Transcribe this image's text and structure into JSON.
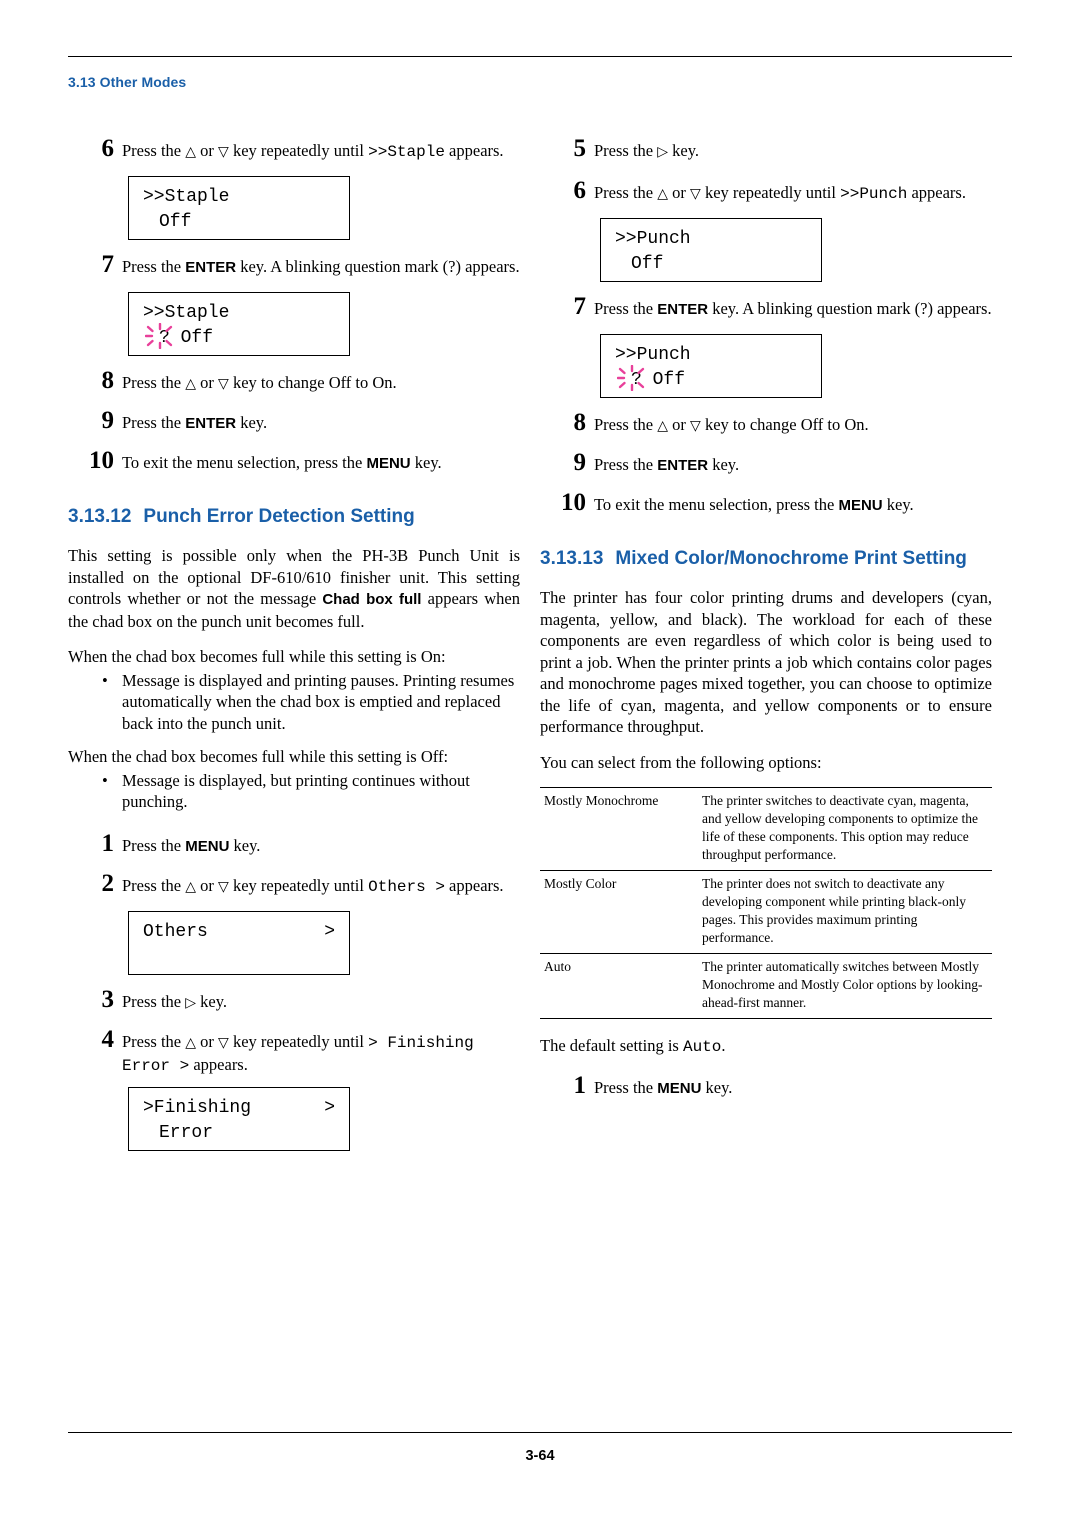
{
  "header": {
    "section": "3.13 Other Modes"
  },
  "footer": {
    "page": "3-64"
  },
  "left": {
    "steps": [
      {
        "num": "6",
        "pre": "Press the ",
        "tri1": "△",
        "mid": " or ",
        "tri2": "▽",
        "post": " key repeatedly until ",
        "mono": ">>Staple",
        "tail": " appears."
      },
      {
        "num": "7",
        "pre": "Press the ",
        "key": "ENTER",
        "post": " key. A blinking question mark (?) appears."
      },
      {
        "num": "8",
        "pre": "Press the ",
        "tri1": "△",
        "mid": " or ",
        "tri2": "▽",
        "post": " key to change Off to On."
      },
      {
        "num": "9",
        "pre": "Press the ",
        "key": "ENTER",
        "post": " key."
      },
      {
        "num": "10",
        "pre": "To exit the menu selection, press the ",
        "key": "MENU",
        "post": " key."
      }
    ],
    "lcd1": {
      "line1": ">>Staple",
      "line2": "Off"
    },
    "lcd2": {
      "line1": ">>Staple",
      "line2": "? Off"
    },
    "section": {
      "number": "3.13.12",
      "title": "Punch Error Detection Setting"
    },
    "para1_a": "This setting is possible only when the PH-3B Punch Unit is installed on the optional DF-610/610 finisher unit. This setting controls whether or not the message ",
    "para1_b": "Chad box full",
    "para1_c": " appears when the chad box on the punch unit becomes full.",
    "para2": "When the chad box becomes full while this setting is On:",
    "bullet1": "Message is displayed and printing pauses. Printing resumes automatically when the chad box is emptied and replaced back into the punch unit.",
    "para3": "When the chad box becomes full while this setting is Off:",
    "bullet2": "Message is displayed, but printing continues without punching.",
    "steps2": [
      {
        "num": "1",
        "pre": "Press the ",
        "key": "MENU",
        "post": " key."
      },
      {
        "num": "2",
        "pre": "Press the ",
        "tri1": "△",
        "mid": " or ",
        "tri2": "▽",
        "post": " key repeatedly until ",
        "mono": "Others >",
        "tail": " appears."
      },
      {
        "num": "3",
        "pre": "Press the ",
        "tri": "▷",
        "post": " key."
      },
      {
        "num": "4",
        "pre": "Press the ",
        "tri1": "△",
        "mid": " or ",
        "tri2": "▽",
        "post": " key repeatedly until ",
        "mono": "> Finishing Error >",
        "tail": " appears."
      }
    ],
    "lcd3": {
      "line1": "Others",
      "arrow": ">"
    },
    "lcd4": {
      "line1": ">Finishing",
      "arrow": ">",
      "line2": "Error"
    }
  },
  "right": {
    "steps": [
      {
        "num": "5",
        "pre": "Press the ",
        "tri": "▷",
        "post": " key."
      },
      {
        "num": "6",
        "pre": "Press the ",
        "tri1": "△",
        "mid": " or ",
        "tri2": "▽",
        "post": " key repeatedly until ",
        "mono": ">>Punch",
        "tail": " appears."
      },
      {
        "num": "7",
        "pre": "Press the ",
        "key": "ENTER",
        "post": " key. A blinking question mark (?) appears."
      },
      {
        "num": "8",
        "pre": "Press the ",
        "tri1": "△",
        "mid": " or ",
        "tri2": "▽",
        "post": " key to change Off to On."
      },
      {
        "num": "9",
        "pre": "Press the ",
        "key": "ENTER",
        "post": " key."
      },
      {
        "num": "10",
        "pre": "To exit the menu selection, press the ",
        "key": "MENU",
        "post": " key."
      }
    ],
    "lcd1": {
      "line1": ">>Punch",
      "line2": "Off"
    },
    "lcd2": {
      "line1": ">>Punch",
      "line2": "? Off"
    },
    "section": {
      "number": "3.13.13",
      "title": "Mixed Color/Monochrome Print Setting"
    },
    "para1": "The printer has four color printing drums and developers (cyan, magenta, yellow, and black). The workload for each of these components are even regardless of which color is being used to print a job. When the printer prints a job which contains color pages and monochrome pages mixed together, you can choose to optimize the life of cyan, magenta, and yellow components or to ensure performance throughput.",
    "para2": "You can select from the following options:",
    "options": [
      {
        "name": "Mostly Monochrome",
        "desc": "The printer switches to deactivate cyan, magenta, and yellow developing components to optimize the life of these components. This option may reduce throughput performance."
      },
      {
        "name": "Mostly Color",
        "desc": "The printer does not switch to deactivate any developing component while printing black-only pages. This provides maximum printing performance."
      },
      {
        "name": "Auto",
        "desc": "The printer automatically switches between Mostly Monochrome and Mostly Color options by looking-ahead-first manner."
      }
    ],
    "default_pre": "The default setting is ",
    "default_mono": "Auto",
    "default_post": ".",
    "step_final": {
      "num": "1",
      "pre": "Press the ",
      "key": "MENU",
      "post": " key."
    }
  },
  "colors": {
    "accent": "#1a5fa8",
    "blink": "#e8409a"
  }
}
